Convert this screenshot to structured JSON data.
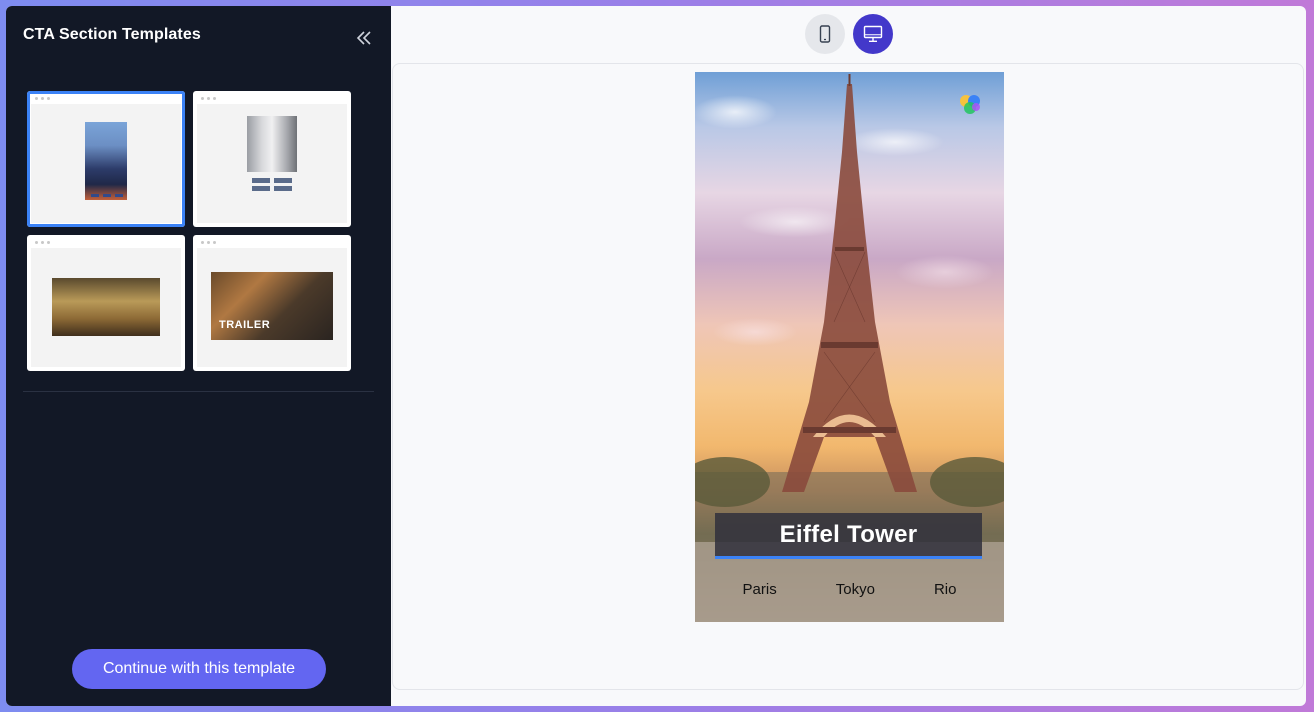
{
  "sidebar": {
    "title": "CTA Section Templates",
    "templates": [
      {
        "id_label": "template-1",
        "selected": true
      },
      {
        "id_label": "template-2",
        "selected": false
      },
      {
        "id_label": "template-3",
        "selected": false
      },
      {
        "id_label": "template-4",
        "selected": false,
        "overlay_text": "TRAILER"
      }
    ],
    "continue_label": "Continue with this template",
    "collapse_icon": "double-chevron-left-icon"
  },
  "toolbar": {
    "mobile_icon": "mobile-icon",
    "desktop_icon": "desktop-icon",
    "active_view": "desktop"
  },
  "preview": {
    "title": "Eiffel Tower",
    "links": [
      "Paris",
      "Tokyo",
      "Rio"
    ]
  },
  "colors": {
    "sidebar_bg": "#121826",
    "accent": "#6366f1",
    "active_view": "#4338ca",
    "selected_outline": "#3b82f6"
  }
}
